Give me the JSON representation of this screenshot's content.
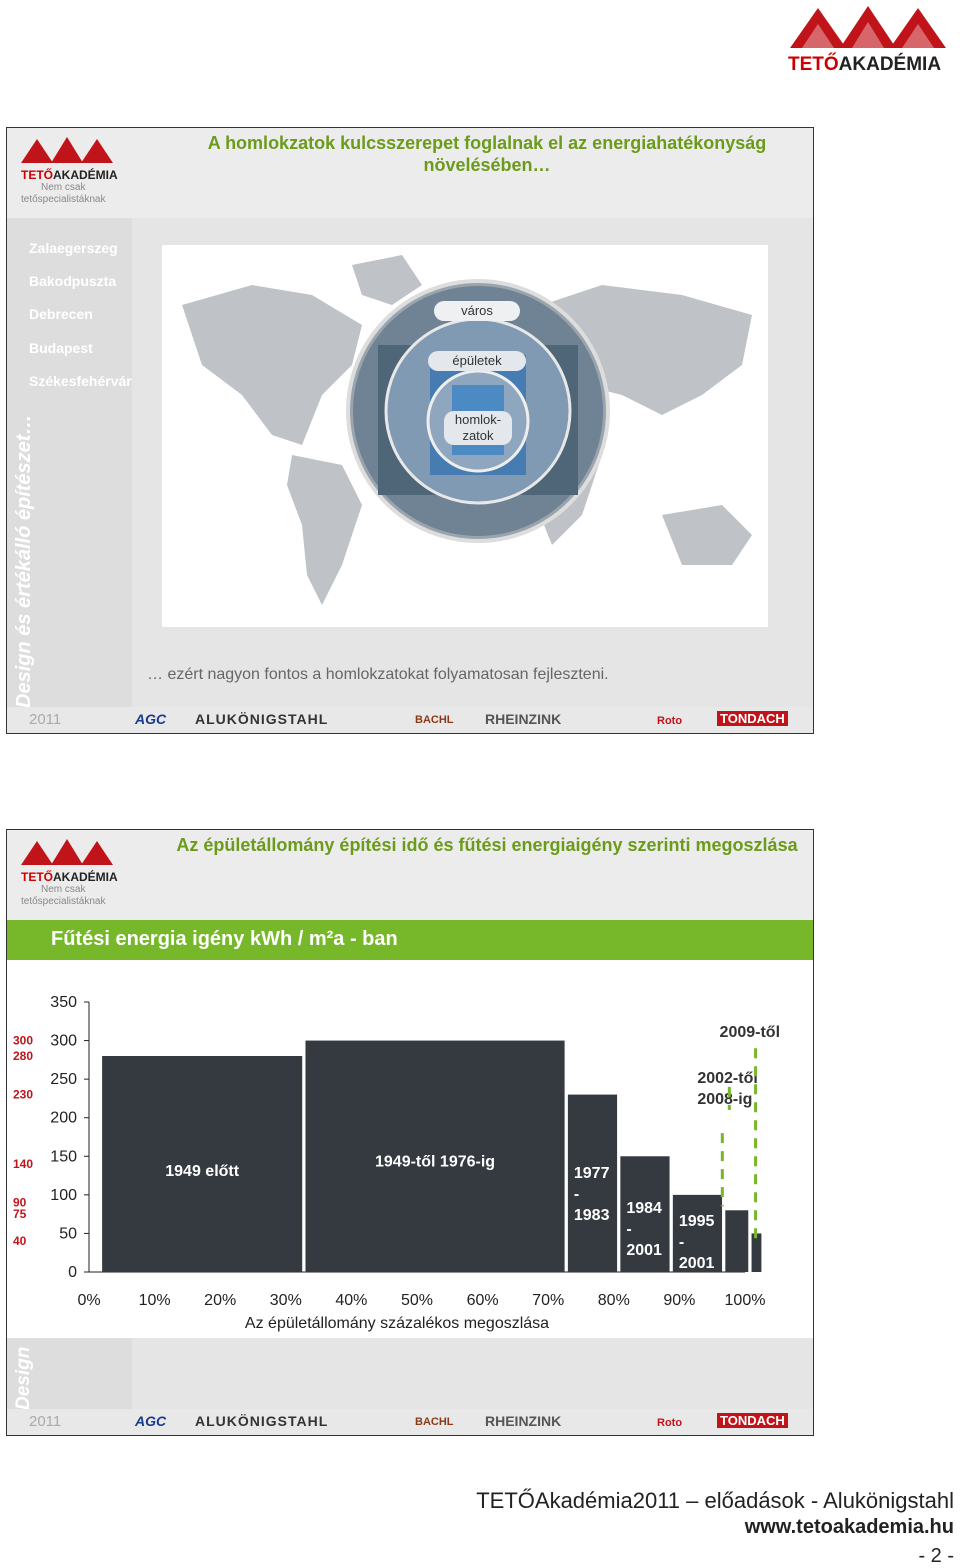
{
  "brand": {
    "logo_name_bold": "TETŐ",
    "logo_name_rest": "AKADÉMIA",
    "tagline_1": "Nem csak",
    "tagline_2": "tetőspecialistáknak"
  },
  "colors": {
    "green": "#76b82a",
    "red": "#c0141a",
    "bar": "#343a40",
    "title": "#6b9b1a"
  },
  "slide1": {
    "title": "A homlokzatok kulcsszerepet foglalnak el az energiahatékonyság növelésében…",
    "cities": [
      "Zalaegerszeg",
      "Bakodpuszta",
      "Debrecen",
      "Budapest",
      "Székesfehérvár"
    ],
    "vertical_text": "Design és értékálló építészet…",
    "circle_labels": {
      "outer": "város",
      "middle": "épületek",
      "inner_1": "homlok-",
      "inner_2": "zatok"
    },
    "caption": "… ezért nagyon fontos a homlokzatokat folyamatosan fejleszteni."
  },
  "footer": {
    "year": "2011",
    "sponsors": [
      "AGC",
      "ALUKÖNIGSTAHL",
      "BACHL",
      "RHEINZINK",
      "Roto",
      "TONDACH"
    ]
  },
  "slide2": {
    "title": "Az épületállomány építési idő és fűtési energiaigény szerinti megoszlása",
    "banner": "Fűtési energia igény kWh / m²a - ban",
    "vertical_text": "Design"
  },
  "chart_data": {
    "type": "bar",
    "title": "",
    "xlabel": "Az épületállomány százalékos megoszlása",
    "ylabel": "",
    "ylim": [
      0,
      350
    ],
    "xlim": [
      0,
      100
    ],
    "y_ticks": [
      "0",
      "50",
      "100",
      "150",
      "200",
      "250",
      "300",
      "350"
    ],
    "x_ticks": [
      "0%",
      "10%",
      "20%",
      "30%",
      "40%",
      "50%",
      "60%",
      "70%",
      "80%",
      "90%",
      "100%"
    ],
    "red_axis_labels": [
      {
        "label": "300",
        "value": 300
      },
      {
        "label": "280",
        "value": 280
      },
      {
        "label": "230",
        "value": 230
      },
      {
        "label": "140",
        "value": 140
      },
      {
        "label": "90",
        "value": 90
      },
      {
        "label": "75",
        "value": 75
      },
      {
        "label": "40",
        "value": 40
      }
    ],
    "bars": [
      {
        "label": "1949 előtt",
        "x_start": 2,
        "x_end": 32.5,
        "value": 280
      },
      {
        "label": "1949-től 1976-ig",
        "x_start": 33,
        "x_end": 72.5,
        "value": 300
      },
      {
        "label": "1977 - 1983",
        "x_start": 73,
        "x_end": 80.5,
        "value": 230
      },
      {
        "label": "1984 - 2001",
        "x_start": 81,
        "x_end": 88.5,
        "value": 150
      },
      {
        "label": "1995 - 2001",
        "x_start": 89,
        "x_end": 96.5,
        "value": 100
      },
      {
        "label": "2002-től 2008-ig",
        "x_start": 97,
        "x_end": 100.5,
        "value": 80
      },
      {
        "label": "2009-től",
        "x_start": 101,
        "x_end": 102.5,
        "value": 50
      }
    ]
  },
  "page": {
    "footer_line": "TETŐAkadémia2011 – előadások - Alukönigstahl",
    "url": "www.tetoakademia.hu",
    "page_number": "- 2 -"
  }
}
